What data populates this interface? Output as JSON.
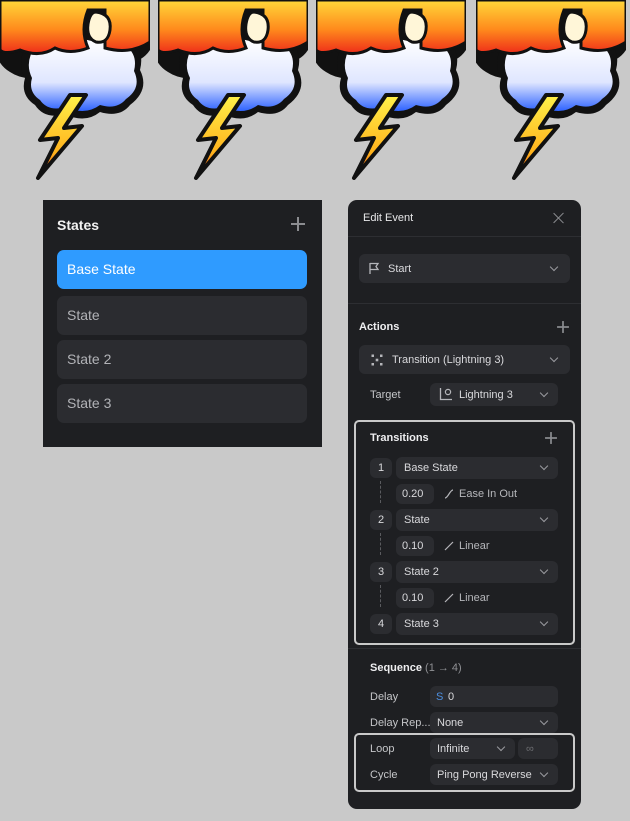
{
  "states_panel": {
    "title": "States",
    "items": [
      {
        "label": "Base State",
        "active": true
      },
      {
        "label": "State",
        "active": false
      },
      {
        "label": "State 2",
        "active": false
      },
      {
        "label": "State 3",
        "active": false
      }
    ]
  },
  "edit_event": {
    "title": "Edit Event",
    "trigger": "Start",
    "actions_label": "Actions",
    "action": "Transition (Lightning 3)",
    "target_label": "Target",
    "target_value": "Lightning 3",
    "transitions_label": "Transitions",
    "transitions": [
      {
        "index": "1",
        "state": "Base State",
        "duration": "0.20",
        "ease": "Ease In Out"
      },
      {
        "index": "2",
        "state": "State",
        "duration": "0.10",
        "ease": "Linear"
      },
      {
        "index": "3",
        "state": "State 2",
        "duration": "0.10",
        "ease": "Linear"
      },
      {
        "index": "4",
        "state": "State 3"
      }
    ],
    "sequence_label": "Sequence",
    "sequence_range": "(1 → 4)",
    "delay_label": "Delay",
    "delay_unit": "S",
    "delay_value": "0",
    "delay_repeat_label": "Delay Rep...",
    "delay_repeat_value": "None",
    "loop_label": "Loop",
    "loop_value": "Infinite",
    "loop_count": "∞",
    "cycle_label": "Cycle",
    "cycle_value": "Ping Pong Reverse"
  },
  "colors": {
    "accent": "#2f9bff",
    "panel_bg": "#1e1f22",
    "field_bg": "#2b2c30"
  }
}
